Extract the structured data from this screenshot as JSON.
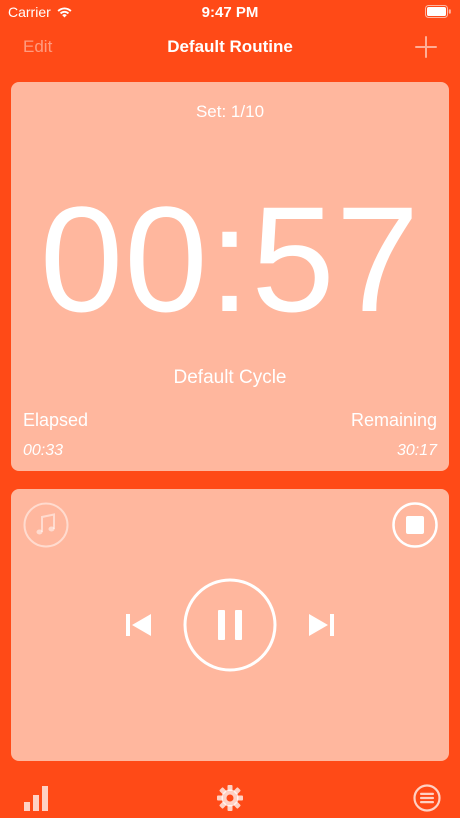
{
  "status_bar": {
    "carrier": "Carrier",
    "time": "9:47 PM"
  },
  "nav": {
    "edit_label": "Edit",
    "title": "Default Routine"
  },
  "timer": {
    "set_label": "Set: 1/10",
    "countdown": "00:57",
    "cycle_name": "Default Cycle",
    "elapsed_label": "Elapsed",
    "elapsed_value": "00:33",
    "remaining_label": "Remaining",
    "remaining_value": "30:17"
  },
  "player": {
    "music_icon": "music-note-icon",
    "stop_icon": "stop-icon",
    "prev_icon": "skip-back-icon",
    "pause_icon": "pause-icon",
    "next_icon": "skip-forward-icon"
  },
  "tab_bar": {
    "items": [
      {
        "icon": "bar-chart-icon"
      },
      {
        "icon": "gear-icon"
      },
      {
        "icon": "list-icon"
      }
    ]
  },
  "colors": {
    "background": "#FF4A17",
    "card": "#FFB79E",
    "foreground": "#FFFFFF"
  }
}
